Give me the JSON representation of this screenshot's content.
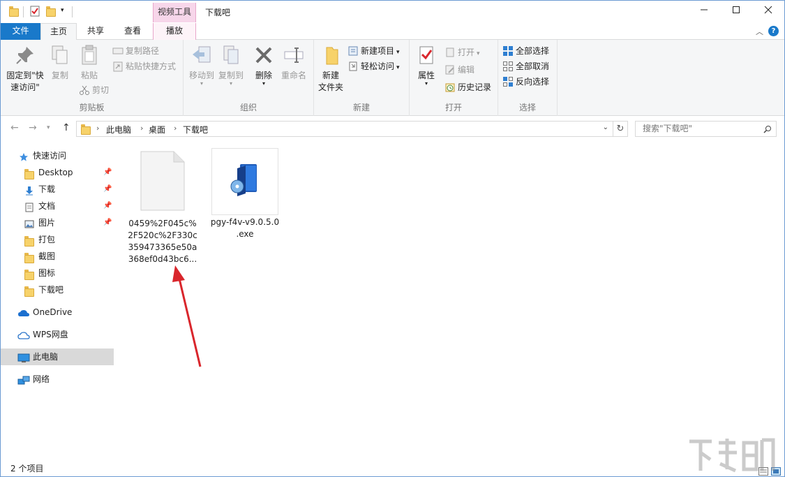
{
  "titlebar": {
    "context_tab_header": "视频工具",
    "title": "下载吧"
  },
  "tabs": {
    "file": "文件",
    "home": "主页",
    "share": "共享",
    "view": "查看",
    "play": "播放"
  },
  "ribbon": {
    "clipboard": {
      "label": "剪贴板",
      "pin_line1": "固定到\"快",
      "pin_line2": "速访问\"",
      "copy": "复制",
      "paste": "粘贴",
      "copy_path": "复制路径",
      "paste_shortcut": "粘贴快捷方式",
      "cut": "剪切"
    },
    "organize": {
      "label": "组织",
      "move_to": "移动到",
      "copy_to": "复制到",
      "delete": "删除",
      "rename": "重命名"
    },
    "new": {
      "label": "新建",
      "new_folder_line1": "新建",
      "new_folder_line2": "文件夹",
      "new_item": "新建项目",
      "easy_access": "轻松访问"
    },
    "open": {
      "label": "打开",
      "properties": "属性",
      "open": "打开",
      "edit": "编辑",
      "history": "历史记录"
    },
    "select": {
      "label": "选择",
      "select_all": "全部选择",
      "select_none": "全部取消",
      "invert": "反向选择"
    }
  },
  "address": {
    "crumbs": [
      "此电脑",
      "桌面",
      "下载吧"
    ],
    "search_placeholder": "搜索\"下载吧\""
  },
  "navpane": {
    "quick_access": "快速访问",
    "items": [
      "Desktop",
      "下载",
      "文档",
      "图片",
      "打包",
      "截图",
      "图标",
      "下载吧"
    ],
    "onedrive": "OneDrive",
    "wps": "WPS网盘",
    "this_pc": "此电脑",
    "network": "网络"
  },
  "files": [
    {
      "name_lines": [
        "0459%2F045c%",
        "2F520c%2F330c",
        "359473365e50a",
        "368ef0d43bc6..."
      ],
      "icon": "blank-file-icon"
    },
    {
      "name_lines": [
        "pgy-f4v-v9.0.5.0",
        ".exe"
      ],
      "icon": "exe-setup-icon"
    }
  ],
  "statusbar": {
    "count": "2 个项目"
  },
  "colors": {
    "accent": "#1979ca",
    "context_tab": "#f7d6ea",
    "arrow": "#d9262c"
  }
}
